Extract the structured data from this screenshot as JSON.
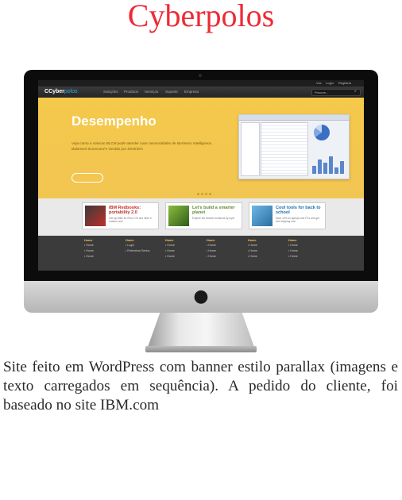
{
  "page": {
    "title": "Cyberpolos",
    "title_color": "#ee2a35"
  },
  "site": {
    "topbar": [
      "Vox",
      "Login",
      "Registrar"
    ],
    "logo_main": "C",
    "logo_rest": "Cyber",
    "logo_blue": "polos",
    "nav": [
      "Soluções",
      "Produtos",
      "Serviços",
      "Suporte",
      "Empresa"
    ],
    "search_placeholder": "Procure...",
    "banner": {
      "title": "Desempenho",
      "text": "Veja como a solucao BLCM pode atender suas necessidades de Business Intelligence, Balanced Scorecard e Gestão por Diretrizes",
      "accent": "#f1c552"
    },
    "cards": [
      {
        "title": "IBM Redbooks: portability 2.0",
        "sub": "Get top titles for iPad, iOS and other e-readers now",
        "color": "#c0302a"
      },
      {
        "title": "Let's build a smarter planet",
        "sub": "Explore the smarter solutions by topic",
        "color": "#5c8a2e"
      },
      {
        "title": "Cool tools for back to school",
        "sub": "Save 10% on laptops and PCs and get free shipping now",
        "color": "#1e6fa8"
      }
    ],
    "footer_columns": [
      {
        "head": "Home",
        "items": [
          "Home",
          "Home",
          "Home"
        ]
      },
      {
        "head": "Home",
        "items": [
          "Login",
          "Relembrar Senha"
        ]
      },
      {
        "head": "Home",
        "items": [
          "Home",
          "Home",
          "Home"
        ]
      },
      {
        "head": "Home",
        "items": [
          "Home",
          "Home",
          "Home"
        ]
      },
      {
        "head": "Home",
        "items": [
          "Home",
          "Home",
          "Home"
        ]
      },
      {
        "head": "Home",
        "items": [
          "Home",
          "Home",
          "Home"
        ]
      }
    ]
  },
  "caption": "Site feito em WordPress com banner estilo parallax (imagens e texto carregados em sequência). A pedido do cliente, foi baseado no site IBM.com",
  "icons": {
    "apple": "apple-logo-icon",
    "search": "search-icon"
  }
}
